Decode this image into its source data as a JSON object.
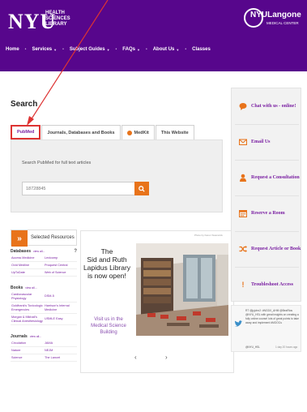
{
  "header": {
    "logo_nyu": "NYU",
    "logo_lib_lines": [
      "HEALTH",
      "SCIENCES",
      "LIBRARY"
    ],
    "langone_name": "NYULangone",
    "langone_sub": "MEDICAL CENTER",
    "bg_color": "#57068c"
  },
  "nav": {
    "items": [
      {
        "label": "Home",
        "dropdown": false
      },
      {
        "label": "Services",
        "dropdown": true
      },
      {
        "label": "Subject Guides",
        "dropdown": true
      },
      {
        "label": "FAQs",
        "dropdown": true
      },
      {
        "label": "About Us",
        "dropdown": true
      },
      {
        "label": "Classes",
        "dropdown": false
      }
    ]
  },
  "search": {
    "title": "Search",
    "tabs": [
      {
        "label": "PubMed",
        "active": true
      },
      {
        "label": "Journals, Databases and Books",
        "active": false
      },
      {
        "label": "MedKit",
        "active": false,
        "icon": "medkit-icon"
      },
      {
        "label": "This Website",
        "active": false
      }
    ],
    "label": "Search PubMed for full text articles",
    "input_value": "18728845",
    "accent": "#e8731a"
  },
  "resources": {
    "heading": "Selected Resources",
    "more_label": "view all...",
    "categories": [
      {
        "name": "Databases",
        "rows": [
          [
            "Access Medicine",
            "Lexicomp"
          ],
          [
            "Ovid Medline",
            "Proquest Central"
          ],
          [
            "UpToDate",
            "Web of Science"
          ]
        ]
      },
      {
        "name": "Books",
        "rows": [
          [
            "Cardiovascular Physiology",
            "DSM-5"
          ],
          [
            "Goldfrank's Toxicologic Emergencies",
            "Harrison's Internal Medicine"
          ],
          [
            "Morgan & Mikhail's Clinical Anesthesiology",
            "USMLE Easy"
          ]
        ]
      },
      {
        "name": "Journals",
        "rows": [
          [
            "Circulation",
            "JAMA"
          ],
          [
            "Nature",
            "NEJM"
          ],
          [
            "Science",
            "The Lancet"
          ]
        ]
      }
    ]
  },
  "promo": {
    "credit": "Photo by Karen Swanwick",
    "headline": [
      "The",
      "Sid and Ruth",
      "Lapidus Library",
      "is now open!"
    ],
    "visit": [
      "Visit us in the",
      "Medical Science Building"
    ],
    "prev": "‹",
    "next": "›"
  },
  "sidebar": {
    "items": [
      {
        "label": "Chat with us - online!",
        "icon": "chat-icon"
      },
      {
        "label": "Email Us",
        "icon": "email-icon"
      },
      {
        "label": "Request a Consultation",
        "icon": "person-icon"
      },
      {
        "label": "Reserve a Room",
        "icon": "calendar-icon"
      },
      {
        "label": "Request Article or Book",
        "icon": "shuffle-icon"
      },
      {
        "label": "Troubleshoot Access",
        "icon": "exclamation-icon"
      }
    ],
    "link_color": "#7a1fa2"
  },
  "tweet": {
    "text": "RT @jyjohn2: #NGDX_AHM @BeaRios @NYU_HSL with great insights on creating a fully online course! lots of great points to take away and implement #MOOCs",
    "handle": "@NYU_HSL",
    "time": "1 day 20 hours ago"
  }
}
